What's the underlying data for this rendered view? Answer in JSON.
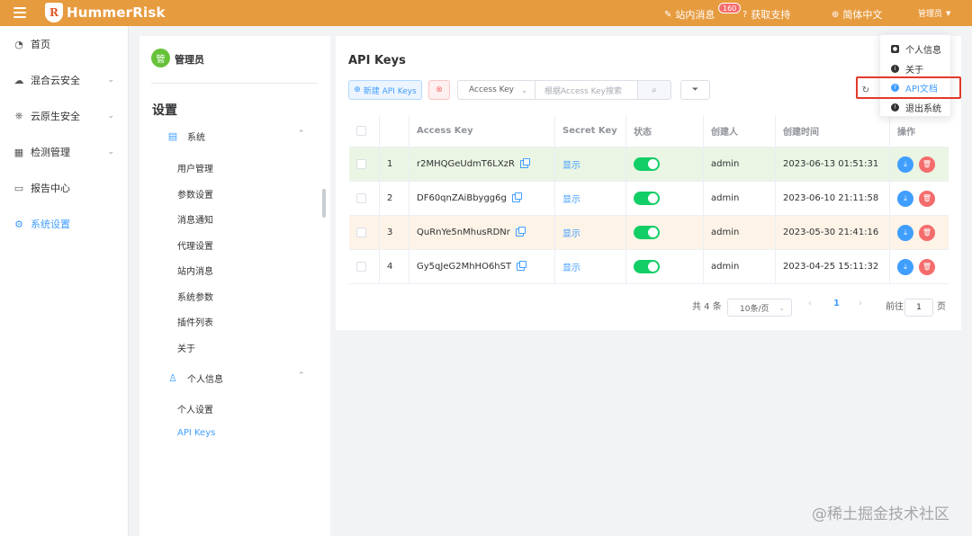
{
  "topbar": {
    "logo_text": "HummerRisk",
    "messages_label": "站内消息",
    "messages_badge": "160",
    "support_label": "获取支持",
    "language_label": "简体中文",
    "user_label": "管理员"
  },
  "sidebar": {
    "items": [
      {
        "label": "首页",
        "icon": "pie-chart-icon"
      },
      {
        "label": "混合云安全",
        "icon": "cloud-icon"
      },
      {
        "label": "云原生安全",
        "icon": "kubernetes-icon"
      },
      {
        "label": "检测管理",
        "icon": "grid-icon"
      },
      {
        "label": "报告中心",
        "icon": "monitor-icon"
      },
      {
        "label": "系统设置",
        "icon": "gear-icon",
        "active": true
      }
    ]
  },
  "settings_panel": {
    "avatar_text": "管",
    "user_name": "管理员",
    "title": "设置",
    "system_group": "系统",
    "system_items": [
      "用户管理",
      "参数设置",
      "消息通知",
      "代理设置",
      "站内消息",
      "系统参数",
      "插件列表",
      "关于"
    ],
    "personal_group": "个人信息",
    "personal_items": [
      "个人设置",
      "API Keys"
    ]
  },
  "main": {
    "title": "API Keys",
    "new_button": "新建 API Keys",
    "search_select": "Access Key",
    "search_placeholder": "根据Access Key搜索",
    "table": {
      "headers": [
        "Access Key",
        "Secret Key",
        "状态",
        "创建人",
        "创建时间",
        "操作"
      ],
      "rows": [
        {
          "index": "1",
          "access_key": "r2MHQGeUdmT6LXzR",
          "secret": "显示",
          "creator": "admin",
          "created": "2023-06-13 01:51:31"
        },
        {
          "index": "2",
          "access_key": "DF60qnZAiBbygg6g",
          "secret": "显示",
          "creator": "admin",
          "created": "2023-06-10 21:11:58"
        },
        {
          "index": "3",
          "access_key": "QuRnYe5nMhusRDNr",
          "secret": "显示",
          "creator": "admin",
          "created": "2023-05-30 21:41:16"
        },
        {
          "index": "4",
          "access_key": "Gy5qJeG2MhHO6hST",
          "secret": "显示",
          "creator": "admin",
          "created": "2023-04-25 15:11:32"
        }
      ]
    },
    "pagination": {
      "total": "共 4 条",
      "page_size": "10条/页",
      "current_page": "1",
      "goto_label": "前往",
      "goto_value": "1",
      "page_suffix": "页"
    }
  },
  "user_dropdown": {
    "items": [
      {
        "label": "个人信息",
        "icon": "user-icon"
      },
      {
        "label": "关于",
        "icon": "info-icon"
      },
      {
        "label": "API文档",
        "icon": "help-icon",
        "active": true
      },
      {
        "label": "退出系统",
        "icon": "logout-icon"
      }
    ]
  },
  "watermark": "@稀土掘金技术社区",
  "colors": {
    "topbar": "#e79b3f",
    "accent": "#409eff",
    "switch_on": "#13ce66",
    "danger": "#f56c6c",
    "highlight": "#e23a2a"
  }
}
